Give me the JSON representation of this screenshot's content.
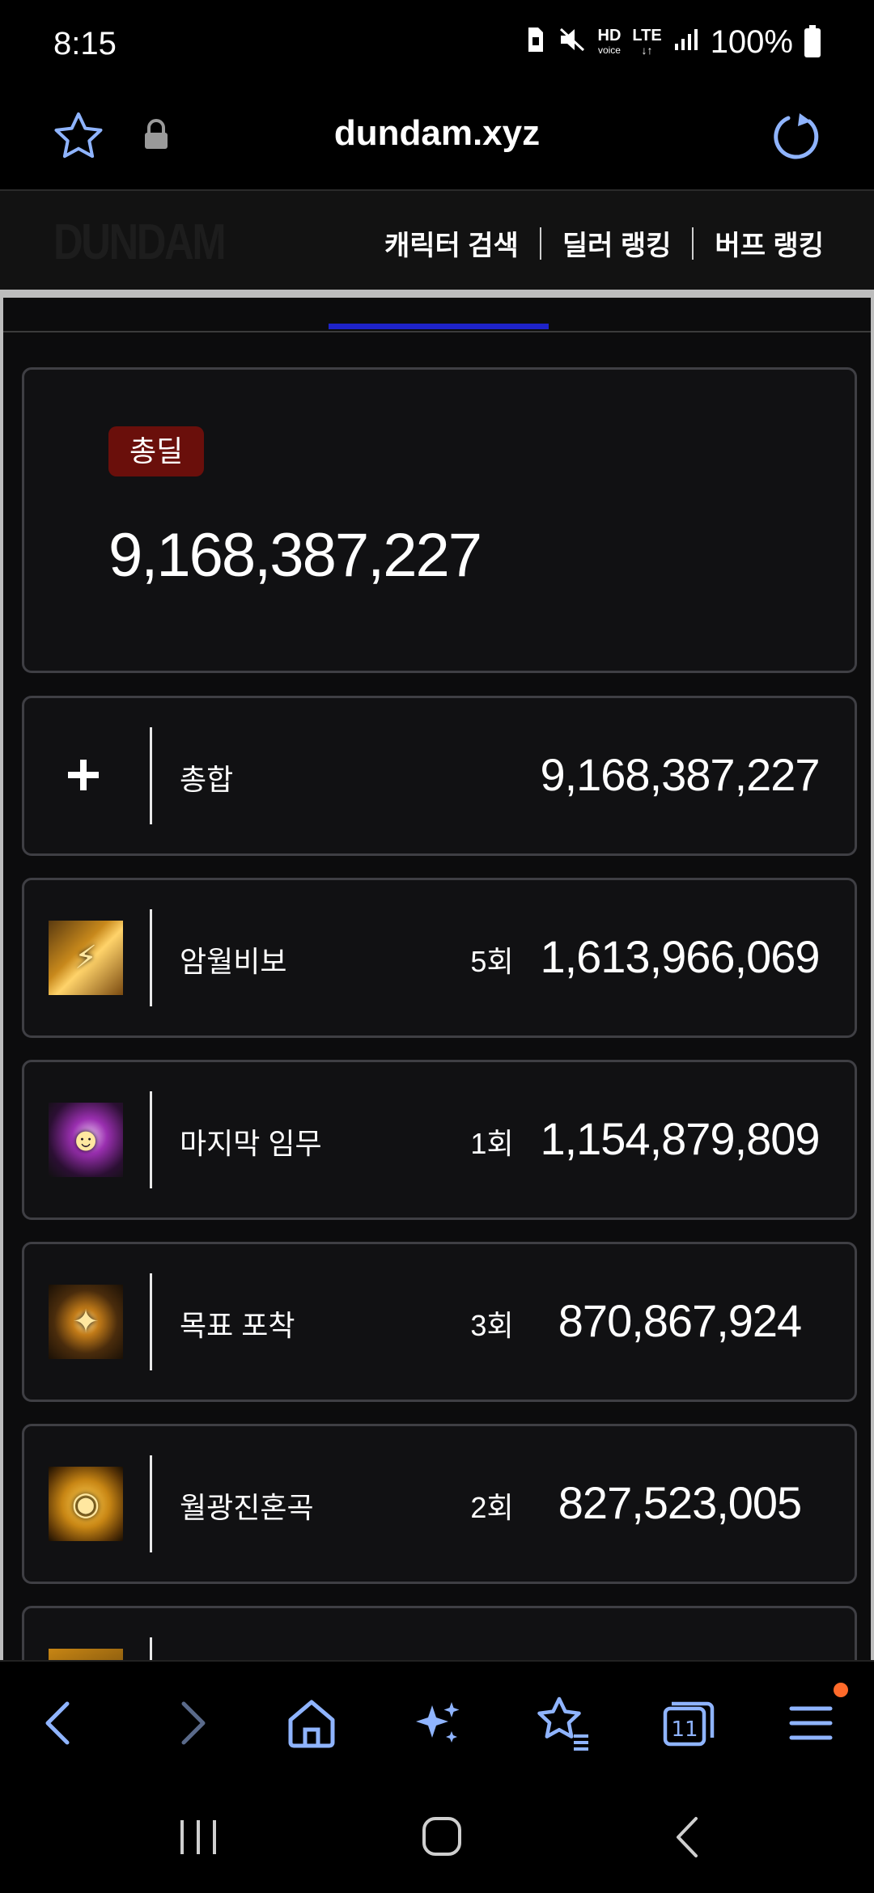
{
  "status": {
    "time": "8:15",
    "hd_label": "HD",
    "voice_label": "voice",
    "lte_label": "LTE",
    "battery_pct": "100%"
  },
  "browser": {
    "url": "dundam.xyz"
  },
  "site": {
    "logo": "DUNDAM",
    "nav": [
      {
        "label": "캐릭터 검색"
      },
      {
        "label": "딜러 랭킹"
      },
      {
        "label": "버프 랭킹"
      }
    ]
  },
  "total": {
    "badge": "총딜",
    "value": "9,168,387,227"
  },
  "summary_row": {
    "name": "총합",
    "value": "9,168,387,227"
  },
  "skills": [
    {
      "name": "암월비보",
      "count": "5회",
      "value": "1,613,966,069",
      "icon": "dark-moon-treasure-icon"
    },
    {
      "name": "마지막 임무",
      "count": "1회",
      "value": "1,154,879,809",
      "icon": "last-mission-icon"
    },
    {
      "name": "목표 포착",
      "count": "3회",
      "value": "870,867,924",
      "icon": "target-lock-icon"
    },
    {
      "name": "월광진혼곡",
      "count": "2회",
      "value": "827,523,005",
      "icon": "moonlight-requiem-icon"
    }
  ],
  "colors": {
    "badge_bg": "#6a0f0b",
    "tab_underline": "#1e23c9",
    "nav_icon": "#8fb4ff",
    "notif_dot": "#ff6a2a"
  }
}
